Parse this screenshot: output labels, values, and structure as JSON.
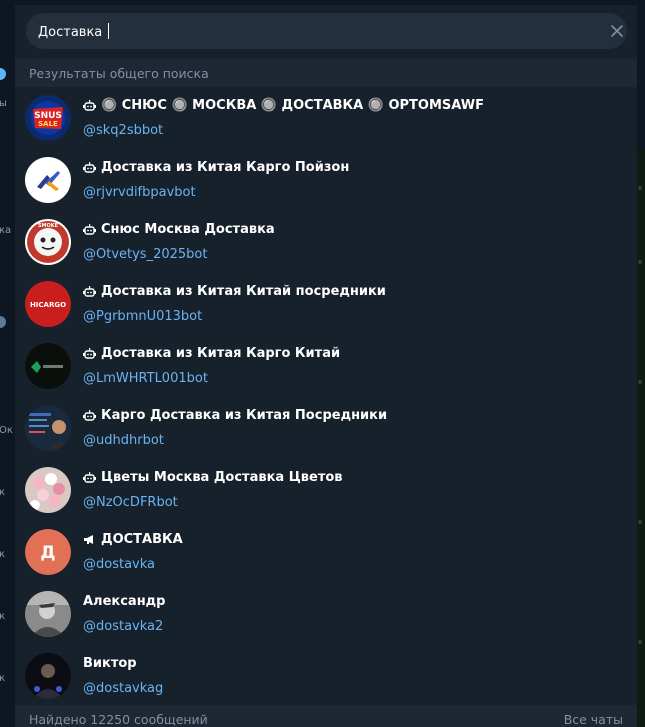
{
  "search": {
    "value": "Доставка"
  },
  "section_title": "Результаты общего поиска",
  "results": [
    {
      "title": "🔘 СНЮС 🔘 МОСКВА 🔘 ДОСТАВКА 🔘 OPTOMSAWF",
      "handle": "@skq2sbbot",
      "type": "bot"
    },
    {
      "title": "Доставка из Китая Карго Пойзон",
      "handle": "@rjvrvdifbpavbot",
      "type": "bot"
    },
    {
      "title": "Снюс Москва Доставка",
      "handle": "@Otvetys_2025bot",
      "type": "bot"
    },
    {
      "title": "Доставка из Китая Китай посредники",
      "handle": "@PgrbmnU013bot",
      "type": "bot"
    },
    {
      "title": "Доставка из Китая Карго Китай",
      "handle": "@LmWHRTL001bot",
      "type": "bot"
    },
    {
      "title": "Карго Доставка из Китая Посредники",
      "handle": "@udhdhrbot",
      "type": "bot"
    },
    {
      "title": "Цветы Москва Доставка Цветов",
      "handle": "@NzOcDFRbot",
      "type": "bot"
    },
    {
      "title": "ДОСТАВКА",
      "handle": "@dostavka",
      "type": "channel",
      "initial": "Д"
    },
    {
      "title": "Александр",
      "handle": "@dostavka2",
      "type": "user"
    },
    {
      "title": "Виктор",
      "handle": "@dostavkag",
      "type": "user"
    }
  ],
  "avatar_labels": {
    "snus_line1": "SNUS",
    "snus_line2": "SALE",
    "smoke": "SMOKE",
    "hicargo": "HICARGO"
  },
  "footer": {
    "found": "Найдено 12250 сообщений",
    "all_chats": "Все чаты"
  },
  "left_strip_labels": [
    "ы",
    "ка",
    "Ок",
    "к",
    "к",
    "к",
    "к"
  ],
  "colors": {
    "panel": "#17212b",
    "input": "#242f3d",
    "link": "#6ab3f3",
    "muted": "#7f91a4",
    "channel_avatar": "#e17055"
  }
}
